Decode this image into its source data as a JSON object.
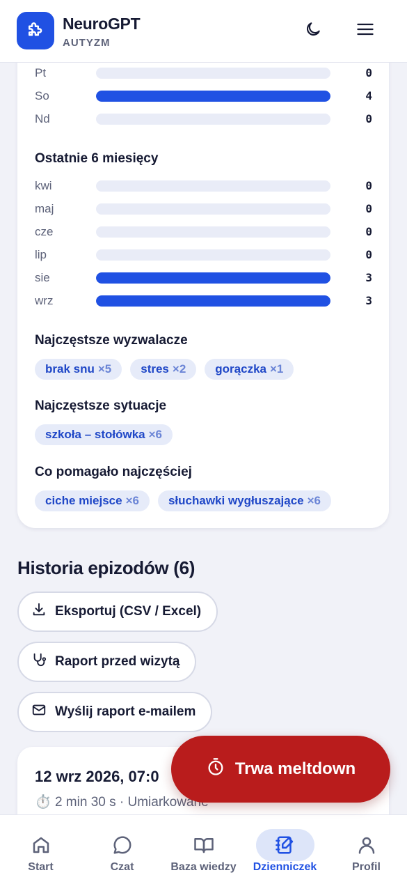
{
  "app": {
    "title": "NeuroGPT",
    "subtitle": "AUTYZM"
  },
  "colors": {
    "accent": "#2051e3",
    "danger": "#b91c1c",
    "chip_bg": "#e6ebf9",
    "background": "#f1f2f8"
  },
  "weekday_chart": {
    "max": 4,
    "rows": [
      {
        "label": "Pt",
        "value": 0
      },
      {
        "label": "So",
        "value": 4
      },
      {
        "label": "Nd",
        "value": 0
      }
    ]
  },
  "months_section": {
    "title": "Ostatnie 6 miesięcy",
    "max": 3,
    "rows": [
      {
        "label": "kwi",
        "value": 0
      },
      {
        "label": "maj",
        "value": 0
      },
      {
        "label": "cze",
        "value": 0
      },
      {
        "label": "lip",
        "value": 0
      },
      {
        "label": "sie",
        "value": 3
      },
      {
        "label": "wrz",
        "value": 3
      }
    ]
  },
  "triggers": {
    "title": "Najczęstsze wyzwalacze",
    "chips": [
      {
        "label": "brak snu",
        "count": "×5"
      },
      {
        "label": "stres",
        "count": "×2"
      },
      {
        "label": "gorączka",
        "count": "×1"
      }
    ]
  },
  "situations": {
    "title": "Najczęstsze sytuacje",
    "chips": [
      {
        "label": "szkoła – stołówka",
        "count": "×6"
      }
    ]
  },
  "helped": {
    "title": "Co pomagało najczęściej",
    "chips": [
      {
        "label": "ciche miejsce",
        "count": "×6"
      },
      {
        "label": "słuchawki wygłuszające",
        "count": "×6"
      }
    ]
  },
  "history": {
    "title": "Historia epizodów (6)",
    "export_label": "Eksportuj (CSV / Excel)",
    "report_label": "Raport przed wizytą",
    "email_label": "Wyślij raport e-mailem",
    "episode": {
      "date": "12 wrz 2026, 07:0",
      "meta": "2 min 30 s · Umiarkowane"
    }
  },
  "meltdown_button": {
    "label": "Trwa meltdown"
  },
  "nav": {
    "items": [
      {
        "label": "Start",
        "icon": "home-icon",
        "active": false
      },
      {
        "label": "Czat",
        "icon": "chat-icon",
        "active": false
      },
      {
        "label": "Baza wiedzy",
        "icon": "book-icon",
        "active": false
      },
      {
        "label": "Dzienniczek",
        "icon": "notebook-icon",
        "active": true
      },
      {
        "label": "Profil",
        "icon": "user-icon",
        "active": false
      }
    ]
  }
}
